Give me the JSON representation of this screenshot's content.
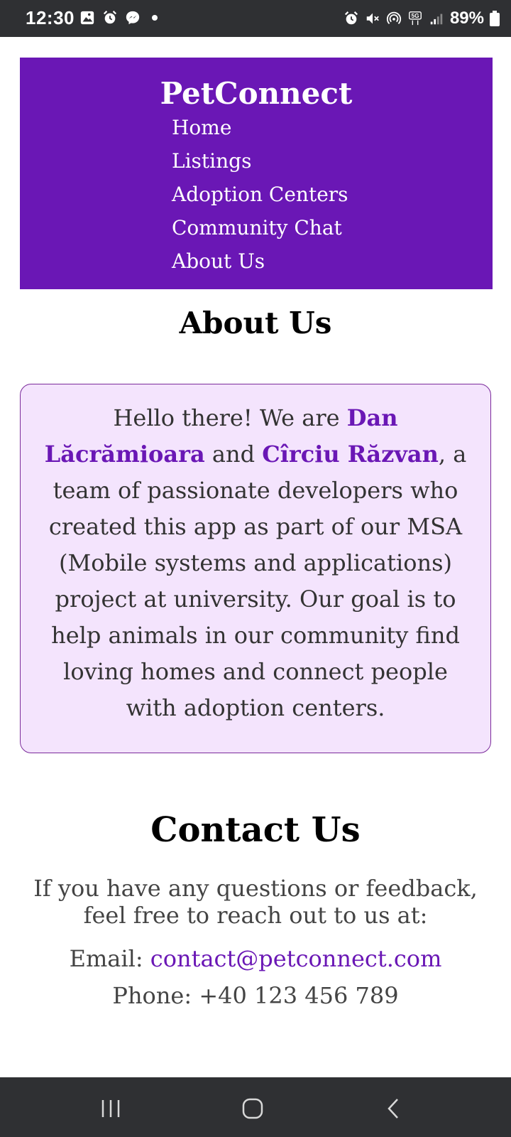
{
  "status_bar": {
    "time": "12:30",
    "battery": "89%",
    "left_icons": [
      "image-icon",
      "alarm-icon",
      "messenger-icon",
      "dot-icon"
    ],
    "right_icons": [
      "alarm-icon",
      "mute-icon",
      "hotspot-icon",
      "5g-icon",
      "signal-icon",
      "battery-icon"
    ]
  },
  "header": {
    "brand": "PetConnect",
    "nav": [
      "Home",
      "Listings",
      "Adoption Centers",
      "Community Chat",
      "About Us"
    ]
  },
  "about": {
    "title": "About Us",
    "text_1": "Hello there! We are ",
    "name_1": "Dan Lăcrămioara",
    "text_2": " and ",
    "name_2": "Cîrciu Răzvan",
    "text_3": ", a team of passionate developers who created this app as part of our MSA (Mobile systems and applications) project at university. Our goal is to help animals in our community find loving homes and connect people with adoption centers."
  },
  "contact": {
    "title": "Contact Us",
    "intro": "If you have any questions or feedback, feel free to reach out to us at:",
    "email_label": "Email: ",
    "email": "contact@petconnect.com",
    "phone": "Phone: +40 123 456 789"
  },
  "system_nav": [
    "recent-apps-icon",
    "home-icon",
    "back-icon"
  ],
  "colors": {
    "accent": "#6a17b5",
    "card_bg": "#f4e4fd",
    "system_bar": "#2f3033"
  }
}
